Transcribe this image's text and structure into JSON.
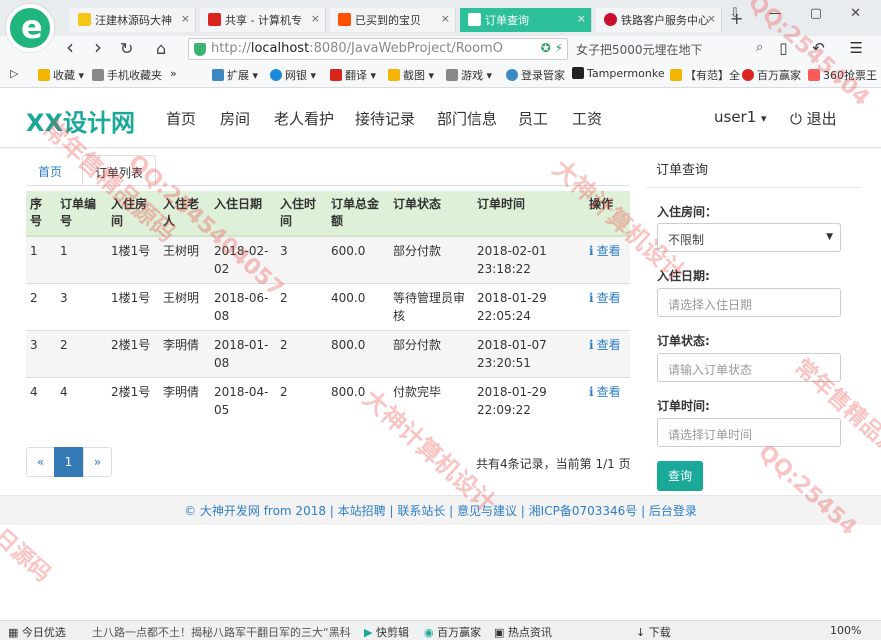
{
  "browser": {
    "tabs": [
      {
        "label": "汪建林源码大神",
        "icon_color": "#f5c518",
        "active": false
      },
      {
        "label": "共享 - 计算机专",
        "icon_color": "#d9251d",
        "active": false
      },
      {
        "label": "已买到的宝贝",
        "icon_color": "#ff5000",
        "active": false
      },
      {
        "label": "订单查询",
        "icon_color": "#ffffff",
        "active": true
      },
      {
        "label": "铁路客户服务中心",
        "icon_color": "#c8102e",
        "active": false
      }
    ],
    "tab_close": "×",
    "new_tab": "+",
    "window_buttons": "⇩ — ▢ ✕",
    "nav_back": "‹",
    "nav_forward": "›",
    "nav_reload": "↻",
    "nav_home": "⌂",
    "url_prefix": "http://",
    "url_host": "localhost",
    "url_rest": ":8080/JavaWebProject/RoomO",
    "search_text": "女子把5000元埋在地下",
    "search_icon": "⌕",
    "nav_right": "▯ ↶ ☰",
    "bookmarks": [
      {
        "label": "收藏",
        "icon_color": "#f5b400"
      },
      {
        "label": "手机收藏夹",
        "icon_color": "#888888"
      },
      {
        "label": "»",
        "icon_color": ""
      },
      {
        "label": "扩展",
        "icon_color": "#3b88c3"
      },
      {
        "label": "网银",
        "icon_color": "#1c8adb"
      },
      {
        "label": "翻译",
        "icon_color": "#d9251d"
      },
      {
        "label": "截图",
        "icon_color": "#f5b400"
      },
      {
        "label": "游戏",
        "icon_color": "#888888"
      },
      {
        "label": "登录管家",
        "icon_color": "#3b88c3"
      },
      {
        "label": "Tampermonke",
        "icon_color": "#222222"
      },
      {
        "label": "【有范】全",
        "icon_color": "#f5b400"
      },
      {
        "label": "百万赢家",
        "icon_color": "#d9251d"
      },
      {
        "label": "360抢票王",
        "icon_color": "#ff5a5a"
      }
    ]
  },
  "header": {
    "logo": "XX设计网",
    "nav": [
      "首页",
      "房间",
      "老人看护",
      "接待记录",
      "部门信息",
      "员工",
      "工资"
    ],
    "user": "user1",
    "user_caret": "▾",
    "logout_icon": "⏻",
    "logout": "退出"
  },
  "content": {
    "tabs": {
      "home": "首页",
      "orders": "订单列表"
    },
    "table": {
      "headers": [
        "序号",
        "订单编号",
        "入住房间",
        "入住老人",
        "入住日期",
        "入住时间",
        "订单总金额",
        "订单状态",
        "订单时间",
        "操作"
      ],
      "rows": [
        {
          "seq": "1",
          "order_no": "1",
          "room": "1楼1号",
          "elder": "王树明",
          "date": "2018-02-02",
          "days": "3",
          "amount": "600.0",
          "status": "部分付款",
          "time": "2018-02-01 23:18:22"
        },
        {
          "seq": "2",
          "order_no": "3",
          "room": "1楼1号",
          "elder": "王树明",
          "date": "2018-06-08",
          "days": "2",
          "amount": "400.0",
          "status": "等待管理员审核",
          "time": "2018-01-29 22:05:24"
        },
        {
          "seq": "3",
          "order_no": "2",
          "room": "2楼1号",
          "elder": "李明倩",
          "date": "2018-01-08",
          "days": "2",
          "amount": "800.0",
          "status": "部分付款",
          "time": "2018-01-07 23:20:51"
        },
        {
          "seq": "4",
          "order_no": "4",
          "room": "2楼1号",
          "elder": "李明倩",
          "date": "2018-04-05",
          "days": "2",
          "amount": "800.0",
          "status": "付款完毕",
          "time": "2018-01-29 22:09:22"
        }
      ],
      "view_icon": "i",
      "view_label": "查看"
    },
    "pager": {
      "prev": "«",
      "current": "1",
      "next": "»"
    },
    "summary": "共有4条记录，当前第 1/1 页"
  },
  "sidebar": {
    "title": "订单查询",
    "room_label": "入住房间：",
    "room_value": "不限制",
    "select_caret": "▼",
    "date_label": "入住日期:",
    "date_placeholder": "请选择入住日期",
    "status_label": "订单状态:",
    "status_placeholder": "请输入订单状态",
    "time_label": "订单时间:",
    "time_placeholder": "请选择订单时间",
    "query_button": "查询"
  },
  "footer": {
    "text": "© 大神开发网 from 2018 | 本站招聘 | 联系站长 | 意见与建议 | 湘ICP备0703346号 | 后台登录"
  },
  "statusbar": {
    "items": [
      "今日优选",
      "土八路一点都不土！揭秘八路军干翻日军的三大“黑科",
      "快剪辑",
      "百万赢家",
      "热点资讯",
      "下载",
      "100%"
    ]
  },
  "watermark": {
    "texts": [
      "QQ:2545404",
      "常年售精品源码",
      "大神计算机设计",
      "QQ:2545404057",
      "大神计算机设计",
      "常年售精品源码",
      "QQ:25454",
      "日源码"
    ]
  }
}
